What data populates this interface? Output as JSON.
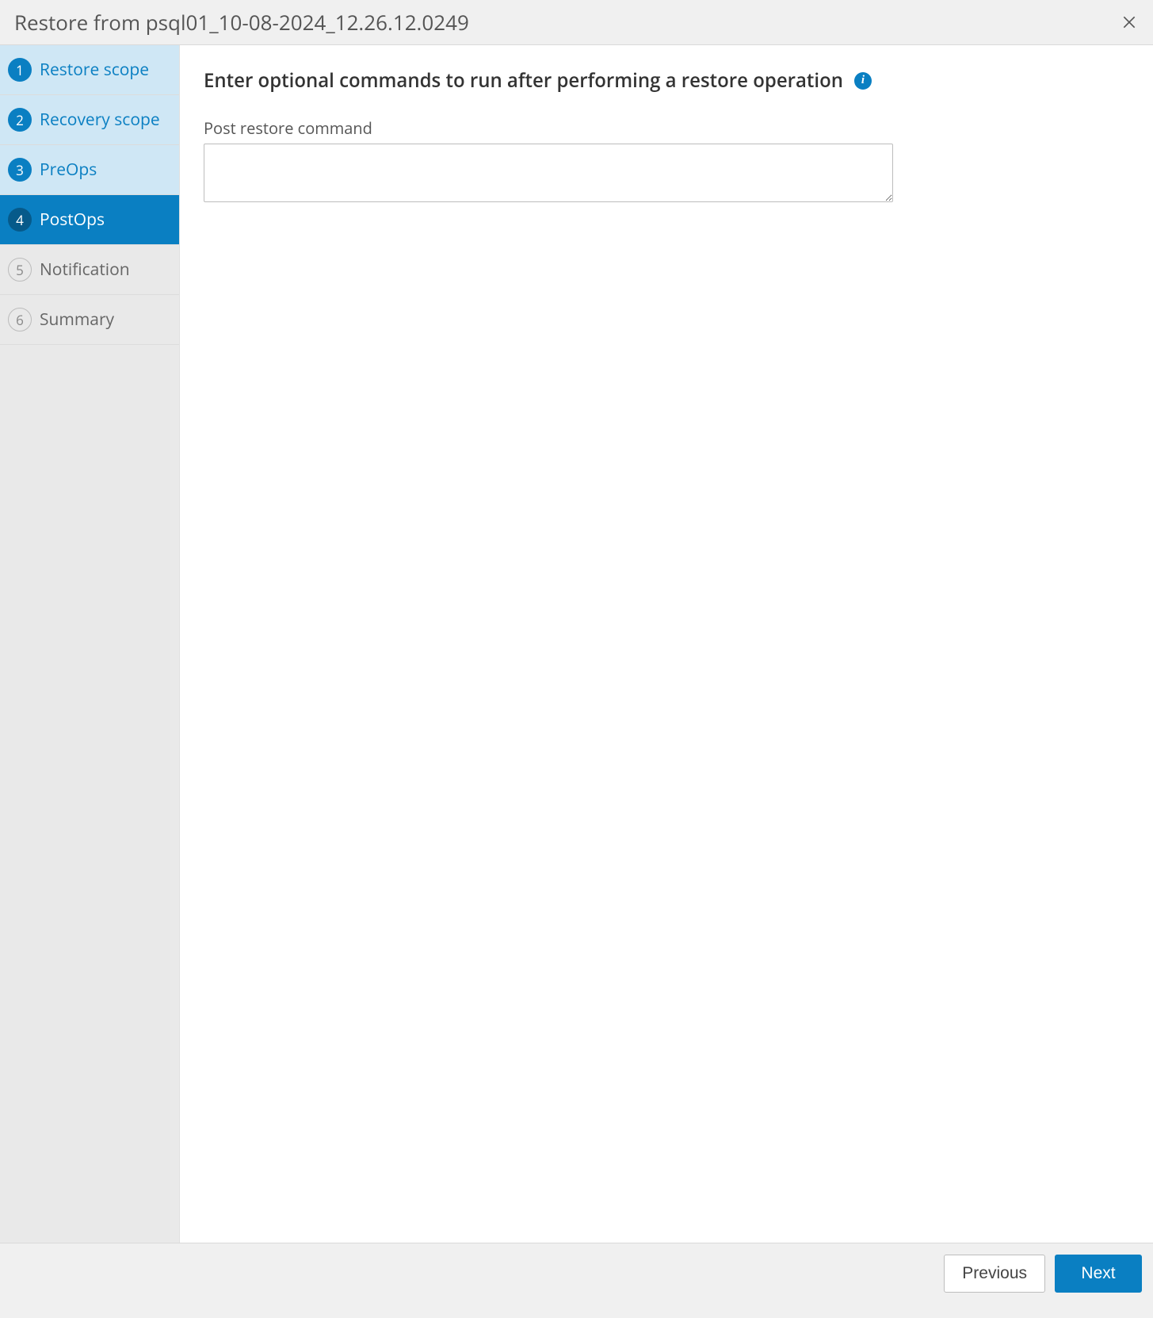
{
  "header": {
    "title": "Restore from psql01_10-08-2024_12.26.12.0249"
  },
  "sidebar": {
    "steps": [
      {
        "num": "1",
        "label": "Restore scope",
        "state": "completed"
      },
      {
        "num": "2",
        "label": "Recovery scope",
        "state": "completed"
      },
      {
        "num": "3",
        "label": "PreOps",
        "state": "completed"
      },
      {
        "num": "4",
        "label": "PostOps",
        "state": "active"
      },
      {
        "num": "5",
        "label": "Notification",
        "state": "pending"
      },
      {
        "num": "6",
        "label": "Summary",
        "state": "pending"
      }
    ]
  },
  "main": {
    "heading": "Enter optional commands to run after performing a restore operation",
    "info_icon_glyph": "i",
    "post_restore_label": "Post restore command",
    "post_restore_value": ""
  },
  "footer": {
    "previous_label": "Previous",
    "next_label": "Next"
  }
}
